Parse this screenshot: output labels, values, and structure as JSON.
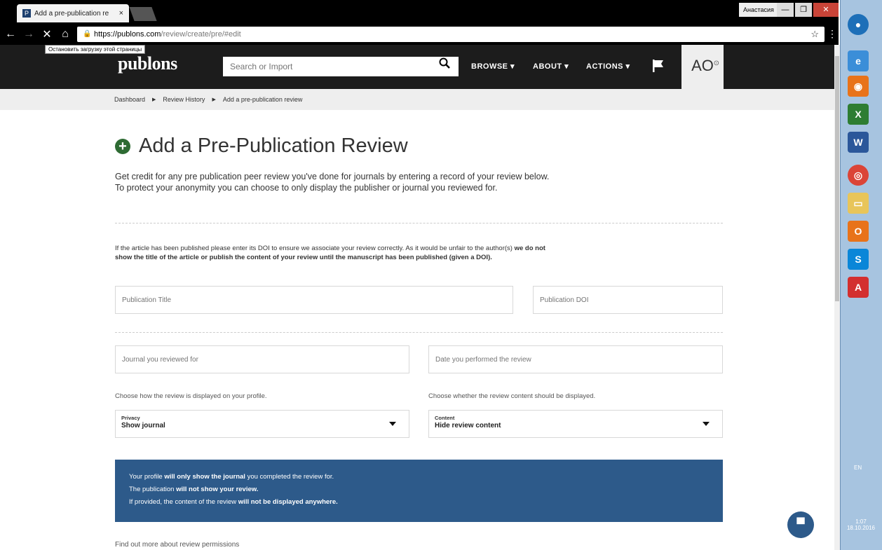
{
  "browser": {
    "tab_title": "Add a pre-publication re",
    "tab_close": "×",
    "user_name": "Анастасия",
    "url_host": "https://publons.com",
    "url_path": "/review/create/pre/#edit",
    "tooltip": "Остановить загрузку этой страницы"
  },
  "header": {
    "logo": "publons",
    "search_placeholder": "Search or Import",
    "nav": {
      "browse": "BROWSE ▾",
      "about": "ABOUT ▾",
      "actions": "ACTIONS ▾"
    },
    "avatar_initials": "AO"
  },
  "breadcrumb": {
    "items": [
      "Dashboard",
      "Review History",
      "Add a pre-publication review"
    ],
    "separator": "▶"
  },
  "page": {
    "title": "Add a Pre-Publication Review",
    "intro": "Get credit for any pre publication peer review you've done for journals by entering a record of your review below. To protect your anonymity you can choose to only display the publisher or journal you reviewed for.",
    "note_part1": "If the article has been published please enter its DOI to ensure we associate your review correctly. As it would be unfair to the author(s) ",
    "note_bold": "we do not show the title of the article or publish the content of your review until the manuscript has been published (given a DOI).",
    "fields": {
      "pub_title": "Publication Title",
      "pub_doi": "Publication DOI",
      "journal": "Journal you reviewed for",
      "date": "Date you performed the review"
    },
    "help_privacy": "Choose how the review is displayed on your profile.",
    "help_content": "Choose whether the review content should be displayed.",
    "privacy": {
      "label": "Privacy",
      "value": "Show journal"
    },
    "content": {
      "label": "Content",
      "value": "Hide review content"
    },
    "info": {
      "line1_a": "Your profile ",
      "line1_b": "will only show the journal",
      "line1_c": " you completed the review for.",
      "line2_a": "The publication ",
      "line2_b": "will not show your review.",
      "line3_a": "If provided, the content of the review ",
      "line3_b": "will not be displayed anywhere."
    },
    "perm_link": "Find out more about review permissions"
  },
  "taskbar": {
    "lang": "EN",
    "time": "1:07",
    "date": "18.10.2016"
  },
  "colors": {
    "accent": "#2d5a8a",
    "header_bg": "#1c1c1c",
    "plus_green": "#2e6b33"
  }
}
